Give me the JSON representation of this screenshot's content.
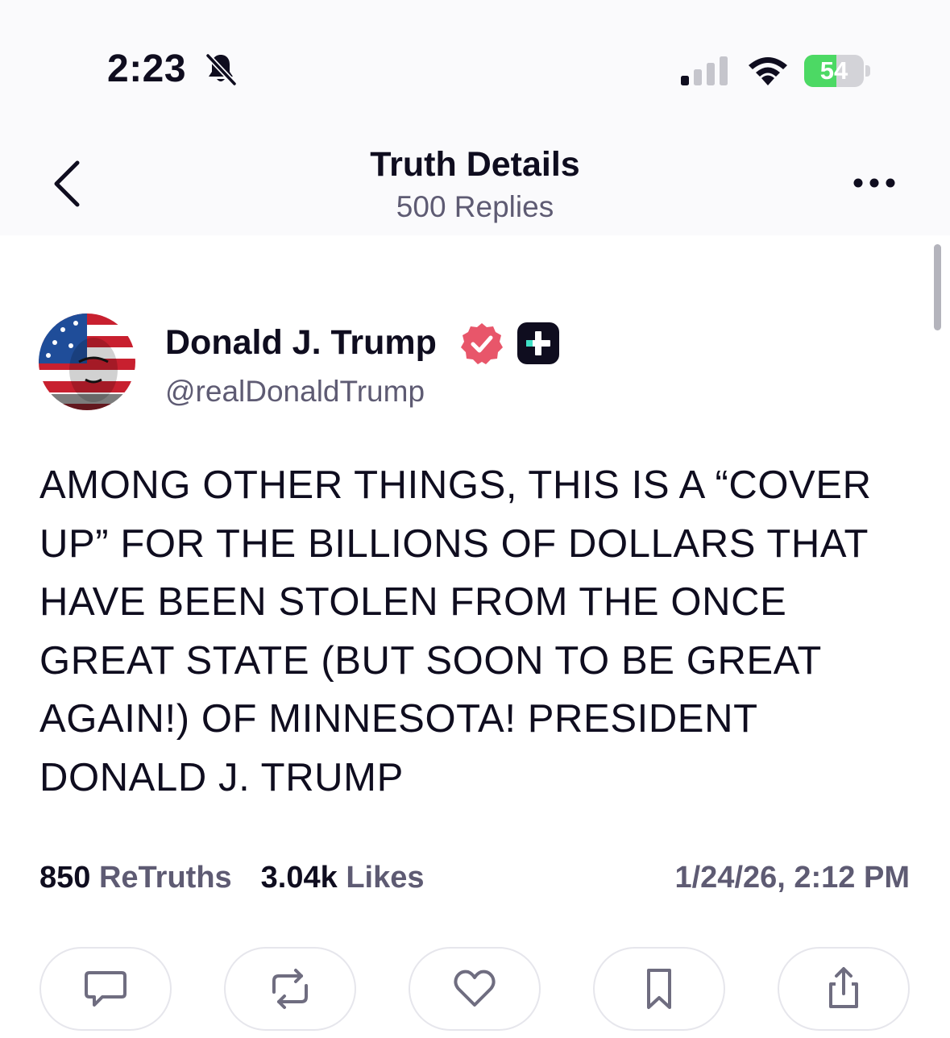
{
  "status_bar": {
    "time": "2:23",
    "battery_level": "54",
    "battery_fraction": 0.54,
    "icons": [
      "bell-slash-icon",
      "signal-icon",
      "wifi-icon",
      "battery-charging-icon"
    ]
  },
  "header": {
    "title": "Truth Details",
    "subtitle": "500 Replies",
    "back_icon": "chevron-left-icon",
    "more_icon": "ellipsis-icon"
  },
  "post": {
    "author": {
      "display_name": "Donald J. Trump",
      "handle": "@realDonaldTrump",
      "verified_badge": "verified-check-icon",
      "verified_color": "#e8566a",
      "plus_badge": "truth-plus-icon"
    },
    "text": "AMONG OTHER THINGS, THIS IS A “COVER UP” FOR THE BILLIONS OF DOLLARS THAT HAVE BEEN STOLEN FROM THE ONCE GREAT STATE (BUT SOON TO BE GREAT AGAIN!) OF MINNESOTA! PRESIDENT DONALD J. TRUMP",
    "stats": {
      "retruths_count": "850",
      "retruths_label": "ReTruths",
      "likes_count": "3.04k",
      "likes_label": "Likes"
    },
    "timestamp": "1/24/26, 2:12 PM"
  },
  "actions": [
    {
      "name": "reply",
      "icon": "comment-icon"
    },
    {
      "name": "retruth",
      "icon": "repost-icon"
    },
    {
      "name": "like",
      "icon": "heart-icon"
    },
    {
      "name": "bookmark",
      "icon": "bookmark-icon"
    },
    {
      "name": "share",
      "icon": "share-icon"
    }
  ],
  "colors": {
    "text_primary": "#0f0d1f",
    "text_secondary": "#5e5b73",
    "battery_green": "#4cd964",
    "icon_gray": "#6f6d80"
  }
}
